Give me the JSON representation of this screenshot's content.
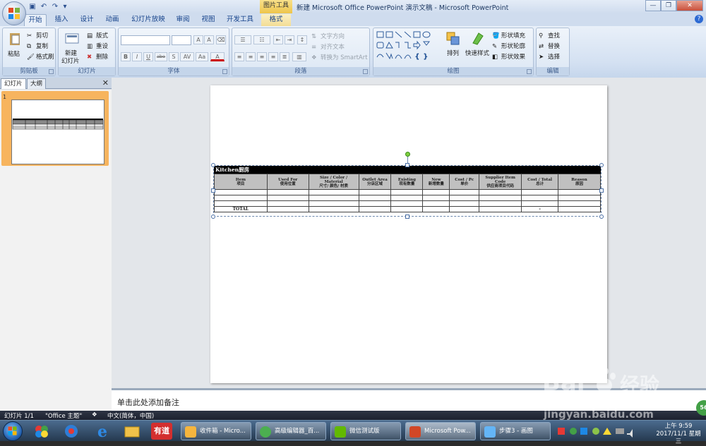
{
  "window": {
    "title": "新建 Microsoft Office PowerPoint 演示文稿 - Microsoft PowerPoint",
    "context_tab_header": "图片工具"
  },
  "tabs": [
    {
      "label": "开始",
      "active": true
    },
    {
      "label": "插入"
    },
    {
      "label": "设计"
    },
    {
      "label": "动画"
    },
    {
      "label": "幻灯片放映"
    },
    {
      "label": "审阅"
    },
    {
      "label": "视图"
    },
    {
      "label": "开发工具"
    },
    {
      "label": "格式",
      "contextual": true
    }
  ],
  "ribbon": {
    "clipboard": {
      "label": "剪贴板",
      "paste": "粘贴",
      "cut": "剪切",
      "copy": "复制",
      "format_painter": "格式刷"
    },
    "slides": {
      "label": "幻灯片",
      "new_slide": "新建",
      "new_slide2": "幻灯片",
      "layout": "版式",
      "reset": "重设",
      "delete": "删除"
    },
    "font": {
      "label": "字体",
      "buttons": [
        "B",
        "I",
        "U",
        "abe",
        "S",
        "AV",
        "Aa",
        "A"
      ]
    },
    "paragraph": {
      "label": "段落",
      "text_direction": "文字方向",
      "align_text": "对齐文本",
      "smartart": "转换为 SmartArt"
    },
    "drawing": {
      "label": "绘图",
      "arrange": "排列",
      "quick_styles": "快速样式",
      "shape_fill": "形状填充",
      "shape_outline": "形状轮廓",
      "shape_effects": "形状效果"
    },
    "editing": {
      "label": "编辑",
      "find": "查找",
      "replace": "替换",
      "select": "选择"
    }
  },
  "left_pane": {
    "tabs": [
      "幻灯片",
      "大纲"
    ],
    "close": "✕",
    "slide_number": "1"
  },
  "table": {
    "title": "Kitchen厨房",
    "headers": [
      [
        "Item",
        "项目"
      ],
      [
        "Used For",
        "使用位置"
      ],
      [
        "Size / Color /",
        "Material",
        "尺寸/ 颜色/ 材质"
      ],
      [
        "Outlet Area",
        "分店区域"
      ],
      [
        "Existing",
        "现有数量"
      ],
      [
        "New",
        "新增数量"
      ],
      [
        "Cost / Pc",
        "单价"
      ],
      [
        "Supplier Item",
        "Code",
        "供应商项目代码"
      ],
      [
        "Cost / Total",
        "总计"
      ],
      [
        "Reason",
        "原因"
      ]
    ],
    "rows": [
      [
        "",
        "",
        "",
        "",
        "",
        "",
        "",
        "",
        "",
        ""
      ],
      [
        "",
        "",
        "",
        "",
        "",
        "",
        "",
        "",
        "",
        ""
      ],
      [
        "",
        "",
        "",
        "",
        "",
        "",
        "",
        "",
        "",
        ""
      ],
      [
        "TOTAL",
        "",
        "",
        "",
        "",
        "",
        "",
        "",
        "-",
        ""
      ]
    ]
  },
  "notes": {
    "placeholder": "单击此处添加备注"
  },
  "statusbar": {
    "slide_info": "幻灯片 1/1",
    "theme": "\"Office 主题\"",
    "language": "中文(简体，中国)"
  },
  "taskbar": {
    "tasks": [
      {
        "label": "收件箱 - Micro..."
      },
      {
        "label": "高级编辑器_百..."
      },
      {
        "label": "微信测试版"
      },
      {
        "label": "Microsoft Pow...",
        "active": true
      },
      {
        "label": "步骤3 - 画图"
      }
    ],
    "pinned": [
      "有道"
    ],
    "clock_time": "上午 9:59",
    "clock_date": "2017/11/1 星期三",
    "badge": "56"
  },
  "watermark": {
    "brand": "Bai",
    "brand2": "经验",
    "url": "jingyan.baidu.com"
  },
  "colors": {
    "ribbon": "#dce7f4",
    "accent": "#15428b",
    "title_row": "#000000",
    "header_fill": "#c0c0c0",
    "thumb_highlight": "#f7b45e"
  }
}
